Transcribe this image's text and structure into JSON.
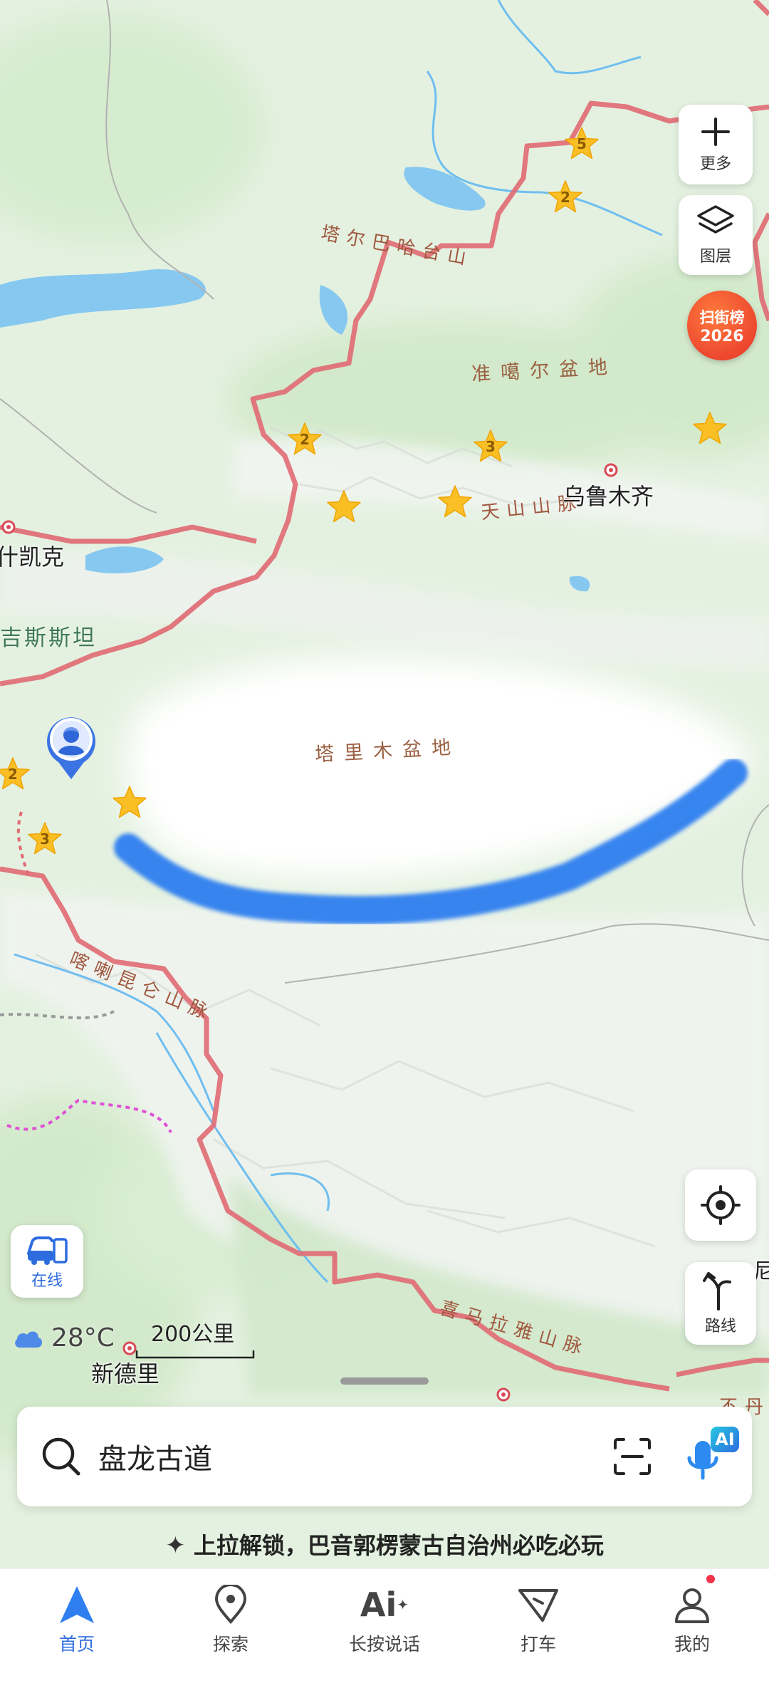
{
  "map": {
    "mountain_labels": [
      "塔尔巴哈台山",
      "天山山脉",
      "喀喇昆仑山脉",
      "喜马拉雅山脉"
    ],
    "basin_labels": [
      "准噶尔盆地",
      "塔里木盆地"
    ],
    "cities": [
      "乌鲁木齐",
      "新德里",
      "什凯克"
    ],
    "country_labels": [
      "吉斯斯坦"
    ],
    "partial_labels": [
      "不丹",
      "尼"
    ],
    "scenic_ratings": [
      "5",
      "2",
      "2",
      "3",
      "2",
      "3"
    ],
    "colors": {
      "route": "#2f7ff0",
      "border": "#e06a73",
      "water": "#7cc3f2",
      "desert": "#ffffff"
    }
  },
  "controls": {
    "more": {
      "label": "更多",
      "icon": "plus-icon"
    },
    "layers": {
      "label": "图层",
      "icon": "layers-icon"
    },
    "rank_badge": {
      "line1": "扫街榜",
      "line2": "2026"
    },
    "locate": {
      "icon": "crosshair-icon"
    },
    "route": {
      "label": "路线",
      "icon": "turn-arrow-icon"
    },
    "online": {
      "label": "在线",
      "icon": "car-phone-icon"
    }
  },
  "weather": {
    "temp": "28°C",
    "icon": "cloud-icon"
  },
  "scale": {
    "label": "200公里"
  },
  "search": {
    "value": "盘龙古道",
    "ai_badge": "AI"
  },
  "hint": "上拉解锁，巴音郭楞蒙古自治州必吃必玩",
  "nav": [
    {
      "label": "首页",
      "icon": "navigation-arrow-icon",
      "active": true
    },
    {
      "label": "探索",
      "icon": "location-pin-icon"
    },
    {
      "label": "长按说话",
      "icon": "ai-voice-icon"
    },
    {
      "label": "打车",
      "icon": "taxi-icon"
    },
    {
      "label": "我的",
      "icon": "user-icon"
    }
  ]
}
